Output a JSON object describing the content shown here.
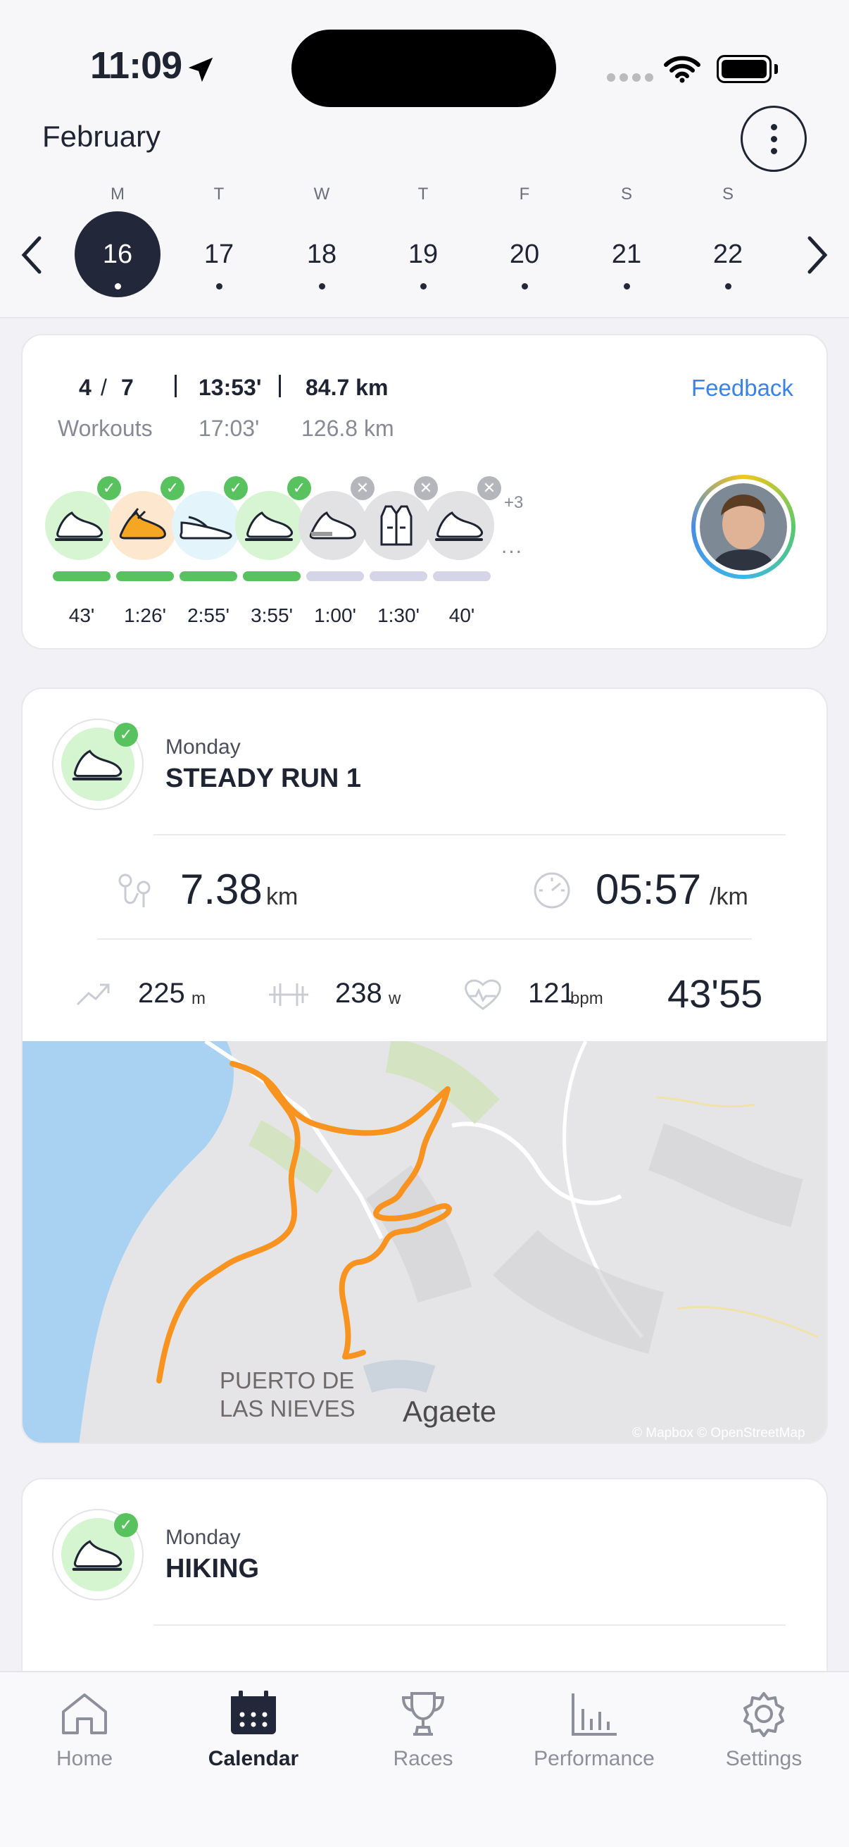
{
  "status": {
    "time": "11:09"
  },
  "header": {
    "month": "February"
  },
  "week": {
    "days": [
      {
        "dow": "M",
        "num": "16"
      },
      {
        "dow": "T",
        "num": "17"
      },
      {
        "dow": "W",
        "num": "18"
      },
      {
        "dow": "T",
        "num": "19"
      },
      {
        "dow": "F",
        "num": "20"
      },
      {
        "dow": "S",
        "num": "21"
      },
      {
        "dow": "S",
        "num": "22"
      }
    ],
    "selected_index": 0
  },
  "summary": {
    "workouts_done": "4",
    "workouts_sep": "/",
    "workouts_total": "7",
    "time_done": "13:53'",
    "distance_done": "84.7 km",
    "workouts_label": "Workouts",
    "time_planned": "17:03'",
    "distance_planned": "126.8 km",
    "feedback_label": "Feedback",
    "extra_count": "+3",
    "more_label": "...",
    "items": [
      {
        "icon": "running-shoe-icon",
        "status": "done",
        "duration": "43'"
      },
      {
        "icon": "trail-shoe-icon",
        "status": "done",
        "duration": "1:26'"
      },
      {
        "icon": "sandal-icon",
        "status": "done",
        "duration": "2:55'"
      },
      {
        "icon": "running-shoe-icon",
        "status": "done",
        "duration": "3:55'"
      },
      {
        "icon": "trail-shoe-icon",
        "status": "missed",
        "duration": "1:00'"
      },
      {
        "icon": "vest-icon",
        "status": "missed",
        "duration": "1:30'"
      },
      {
        "icon": "running-shoe-icon",
        "status": "missed",
        "duration": "40'"
      }
    ],
    "colors": {
      "done": "#58c25e",
      "missed": "#d4d5e8"
    }
  },
  "workout1": {
    "day": "Monday",
    "title": "STEADY RUN 1",
    "distance": "7.38",
    "distance_unit": "km",
    "pace": "05:57",
    "pace_unit": "/km",
    "elevation": "225",
    "elevation_unit": "m",
    "power": "238",
    "power_unit": "w",
    "heart_rate": "121",
    "heart_rate_unit": "bpm",
    "duration": "43'55",
    "map": {
      "place1_line1": "PUERTO DE",
      "place1_line2": "LAS NIEVES",
      "place2": "Agaete",
      "attribution": "© Mapbox © OpenStreetMap"
    }
  },
  "workout2": {
    "day": "Monday",
    "title": "HIKING"
  },
  "tabbar": {
    "tabs": [
      {
        "label": "Home",
        "icon": "home-icon"
      },
      {
        "label": "Calendar",
        "icon": "calendar-icon"
      },
      {
        "label": "Races",
        "icon": "trophy-icon"
      },
      {
        "label": "Performance",
        "icon": "bar-chart-icon"
      },
      {
        "label": "Settings",
        "icon": "gear-icon"
      }
    ],
    "active_index": 1
  }
}
